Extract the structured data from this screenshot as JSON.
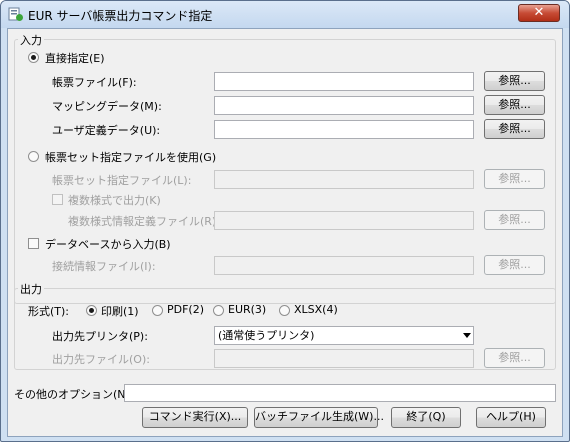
{
  "window": {
    "title": "EUR サーバ帳票出力コマンド指定",
    "close_label": "✕"
  },
  "input_group": {
    "legend": "入力",
    "direct": {
      "label": "直接指定(E)",
      "selected": true,
      "form_file_label": "帳票ファイル(F):",
      "form_file_value": "",
      "mapping_label": "マッピングデータ(M):",
      "mapping_value": "",
      "user_def_label": "ユーザ定義データ(U):",
      "user_def_value": ""
    },
    "formset": {
      "label": "帳票セット指定ファイルを使用(G)",
      "selected": false,
      "formset_file_label": "帳票セット指定ファイル(L):",
      "multi_style_label": "複数様式で出力(K)",
      "multi_style_def_label": "複数様式情報定義ファイル(R):"
    },
    "database": {
      "label": "データベースから入力(B)",
      "checked": false,
      "conn_file_label": "接続情報ファイル(I):"
    },
    "browse_label": "参照..."
  },
  "output_group": {
    "legend": "出力",
    "format_label": "形式(T):",
    "formats": [
      {
        "label": "印刷(1)",
        "selected": true
      },
      {
        "label": "PDF(2)",
        "selected": false
      },
      {
        "label": "EUR(3)",
        "selected": false
      },
      {
        "label": "XLSX(4)",
        "selected": false
      }
    ],
    "printer_label": "出力先プリンタ(P):",
    "printer_value": "(通常使うプリンタ)",
    "output_file_label": "出力先ファイル(O):",
    "browse_label": "参照..."
  },
  "other_options": {
    "label": "その他のオプション(N):",
    "value": ""
  },
  "buttons": {
    "run": "コマンド実行(X)...",
    "batch": "バッチファイル生成(W)...",
    "exit": "終了(Q)",
    "help": "ヘルプ(H)"
  }
}
